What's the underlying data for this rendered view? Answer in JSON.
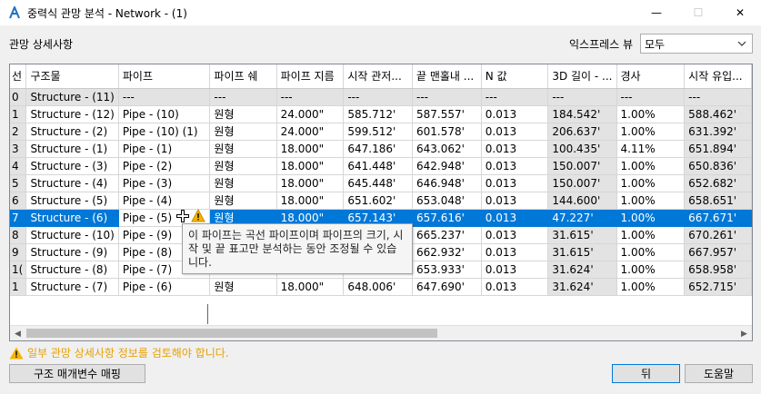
{
  "window": {
    "title": "중력식 관망 분석 - Network - (1)",
    "minimize": "—",
    "maximize": "☐",
    "close": "✕"
  },
  "section_label": "관망 상세사항",
  "view": {
    "label": "익스프레스 뷰",
    "value": "모두"
  },
  "columns": [
    "선",
    "구조물",
    "파이프",
    "파이프 쉐",
    "파이프 지름",
    "시작 관저...",
    "끝 맨홀내 ...",
    "N 값",
    "3D 길이 - ...",
    "경사",
    "시작 유입..."
  ],
  "rows": [
    [
      "0",
      "Structure - (11)",
      "---",
      "---",
      "---",
      "---",
      "---",
      "---",
      "---",
      "---",
      "---"
    ],
    [
      "1",
      "Structure - (12)",
      "Pipe - (10)",
      "원형",
      "24.000\"",
      "585.712'",
      "587.557'",
      "0.013",
      "184.542'",
      "1.00%",
      "588.462'"
    ],
    [
      "2",
      "Structure - (2)",
      "Pipe - (10) (1)",
      "원형",
      "24.000\"",
      "599.512'",
      "601.578'",
      "0.013",
      "206.637'",
      "1.00%",
      "631.392'"
    ],
    [
      "3",
      "Structure - (1)",
      "Pipe - (1)",
      "원형",
      "18.000\"",
      "647.186'",
      "643.062'",
      "0.013",
      "100.435'",
      "4.11%",
      "651.894'"
    ],
    [
      "4",
      "Structure - (3)",
      "Pipe - (2)",
      "원형",
      "18.000\"",
      "641.448'",
      "642.948'",
      "0.013",
      "150.007'",
      "1.00%",
      "650.836'"
    ],
    [
      "5",
      "Structure - (4)",
      "Pipe - (3)",
      "원형",
      "18.000\"",
      "645.448'",
      "646.948'",
      "0.013",
      "150.007'",
      "1.00%",
      "652.682'"
    ],
    [
      "6",
      "Structure - (5)",
      "Pipe - (4)",
      "원형",
      "18.000\"",
      "651.602'",
      "653.048'",
      "0.013",
      "144.600'",
      "1.00%",
      "658.651'"
    ],
    [
      "7",
      "Structure - (6)",
      "Pipe - (5)",
      "원형",
      "18.000\"",
      "657.143'",
      "657.616'",
      "0.013",
      "47.227'",
      "1.00%",
      "667.671'"
    ],
    [
      "8",
      "Structure - (10)",
      "Pipe - (9)",
      "",
      "",
      "",
      "665.237'",
      "0.013",
      "31.615'",
      "1.00%",
      "670.261'"
    ],
    [
      "9",
      "Structure - (9)",
      "Pipe - (8)",
      "",
      "",
      "",
      "662.932'",
      "0.013",
      "31.615'",
      "1.00%",
      "667.957'"
    ],
    [
      "1(",
      "Structure - (8)",
      "Pipe - (7)",
      "",
      "",
      "",
      "653.933'",
      "0.013",
      "31.624'",
      "1.00%",
      "658.958'"
    ],
    [
      "1",
      "Structure - (7)",
      "Pipe - (6)",
      "원형",
      "18.000\"",
      "648.006'",
      "647.690'",
      "0.013",
      "31.624'",
      "1.00%",
      "652.715'"
    ]
  ],
  "selected_row": 7,
  "tooltip": "이 파이프는 곡선 파이프이며 파이프의 크기, 시작 및 끝 표고만 분석하는 동안 조정될 수 있습니다.",
  "status_message": "일부 관망 상세사항 정보를 검토해야 합니다.",
  "buttons": {
    "map_params": "구조 매개변수 매핑",
    "back": "뒤",
    "help": "도움말"
  },
  "colors": {
    "selection": "#0078d7",
    "warning": "#e8a000",
    "readonly_cell": "#e3e3e3"
  }
}
